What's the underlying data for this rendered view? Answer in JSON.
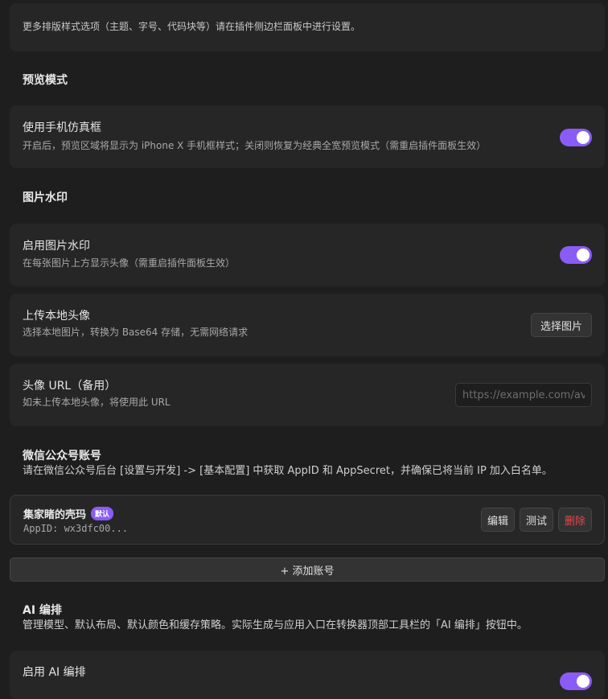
{
  "intro_card": {
    "text": "更多排版样式选项（主题、字号、代码块等）请在插件侧边栏面板中进行设置。"
  },
  "preview_section": {
    "heading": "预览模式",
    "phone_frame": {
      "title": "使用手机仿真框",
      "desc": "开启后，预览区域将显示为 iPhone X 手机框样式；关闭则恢复为经典全宽预览模式（需重启插件面板生效）",
      "enabled": true
    }
  },
  "watermark_section": {
    "heading": "图片水印",
    "enable_watermark": {
      "title": "启用图片水印",
      "desc": "在每张图片上方显示头像（需重启插件面板生效）",
      "enabled": true
    },
    "upload_avatar": {
      "title": "上传本地头像",
      "desc": "选择本地图片，转换为 Base64 存储，无需网络请求",
      "button_label": "选择图片"
    },
    "avatar_url": {
      "title": "头像 URL（备用）",
      "desc": "如未上传本地头像，将使用此 URL",
      "placeholder": "https://example.com/avatar.png"
    }
  },
  "wechat_section": {
    "heading": "微信公众号账号",
    "desc": "请在微信公众号后台 [设置与开发] -> [基本配置] 中获取 AppID 和 AppSecret，并确保已将当前 IP 加入白名单。",
    "accounts": [
      {
        "name": "集家睹的壳玛",
        "badge": "默认",
        "appid": "AppID: wx3dfc00...",
        "edit_label": "编辑",
        "test_label": "测试",
        "delete_label": "删除"
      }
    ],
    "add_account_label": "+ 添加账号"
  },
  "ai_section": {
    "heading": "AI 编排",
    "desc": "管理模型、默认布局、默认颜色和缓存策略。实际生成与应用入口在转换器顶部工具栏的「AI 编排」按钮中。",
    "enable_ai": {
      "title": "启用 AI 编排",
      "enabled": true
    }
  },
  "colors": {
    "accent": "#8a5cf6",
    "danger": "#e5484d",
    "card_bg": "#262626",
    "page_bg": "#1e1e1e"
  }
}
